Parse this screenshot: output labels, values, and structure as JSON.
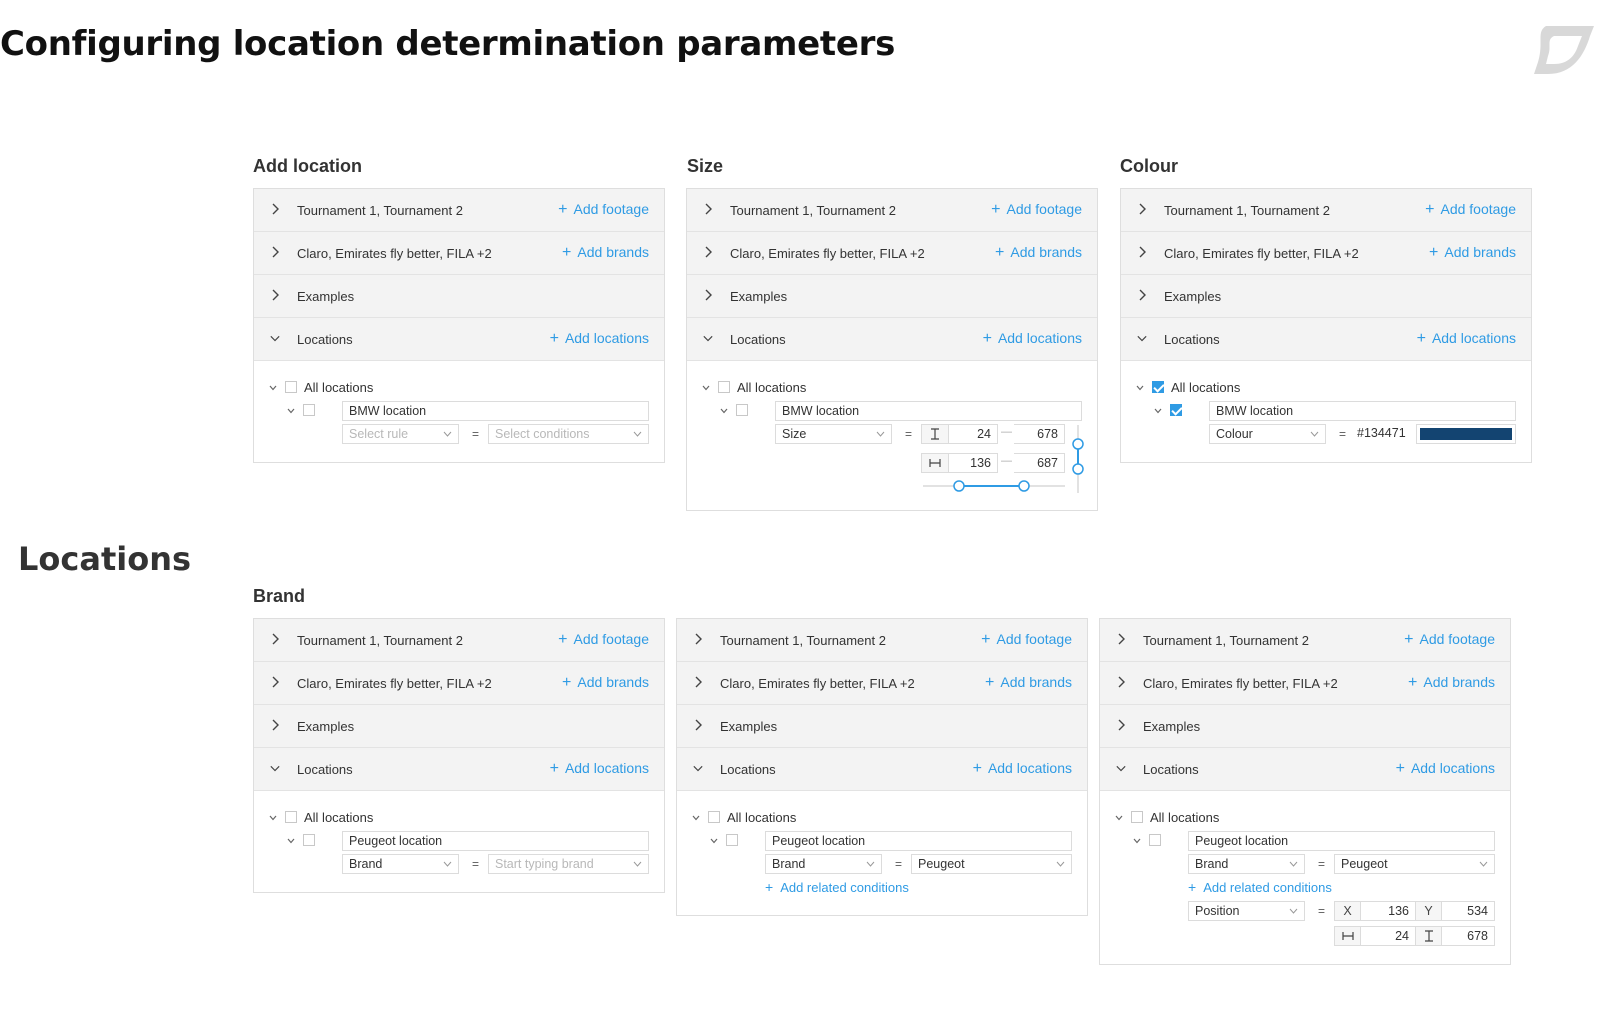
{
  "page": {
    "title": "Configuring location determination parameters",
    "section2": "Locations"
  },
  "rows": {
    "footage": "Tournament 1, Tournament 2",
    "add_footage": "Add footage",
    "brands": "Claro, Emirates fly better, FILA +2",
    "add_brands": "Add brands",
    "examples": "Examples",
    "locations": "Locations",
    "add_locations": "Add locations",
    "all_locations": "All locations",
    "add_related": "Add related conditions"
  },
  "panel_titles": {
    "add_location": "Add location",
    "size": "Size",
    "colour": "Colour",
    "brand": "Brand"
  },
  "p1": {
    "location_name": "BMW location",
    "rule_placeholder": "Select rule",
    "conditions_placeholder": "Select conditions",
    "eq": "="
  },
  "p2": {
    "location_name": "BMW location",
    "rule": "Size",
    "eq": "=",
    "height_from": "24",
    "height_to": "678",
    "width_from": "136",
    "width_to": "687",
    "dash": "—"
  },
  "p3": {
    "location_name": "BMW location",
    "rule": "Colour",
    "eq": "=",
    "hex": "#134471",
    "swatch_color": "#134471",
    "all_checked": true,
    "item_checked": true
  },
  "p4": {
    "location_name": "Peugeot location",
    "rule": "Brand",
    "eq": "=",
    "brand_placeholder": "Start typing brand"
  },
  "p5": {
    "location_name": "Peugeot location",
    "rule": "Brand",
    "eq": "=",
    "brand": "Peugeot"
  },
  "p6": {
    "location_name": "Peugeot location",
    "rule": "Brand",
    "eq": "=",
    "brand": "Peugeot",
    "rule2": "Position",
    "x_label": "X",
    "x": "136",
    "y_label": "Y",
    "y": "534",
    "w": "24",
    "h": "678"
  },
  "colors": {
    "accent": "#2f9be4",
    "row_bg": "#f3f3f3",
    "border": "#dedede"
  }
}
